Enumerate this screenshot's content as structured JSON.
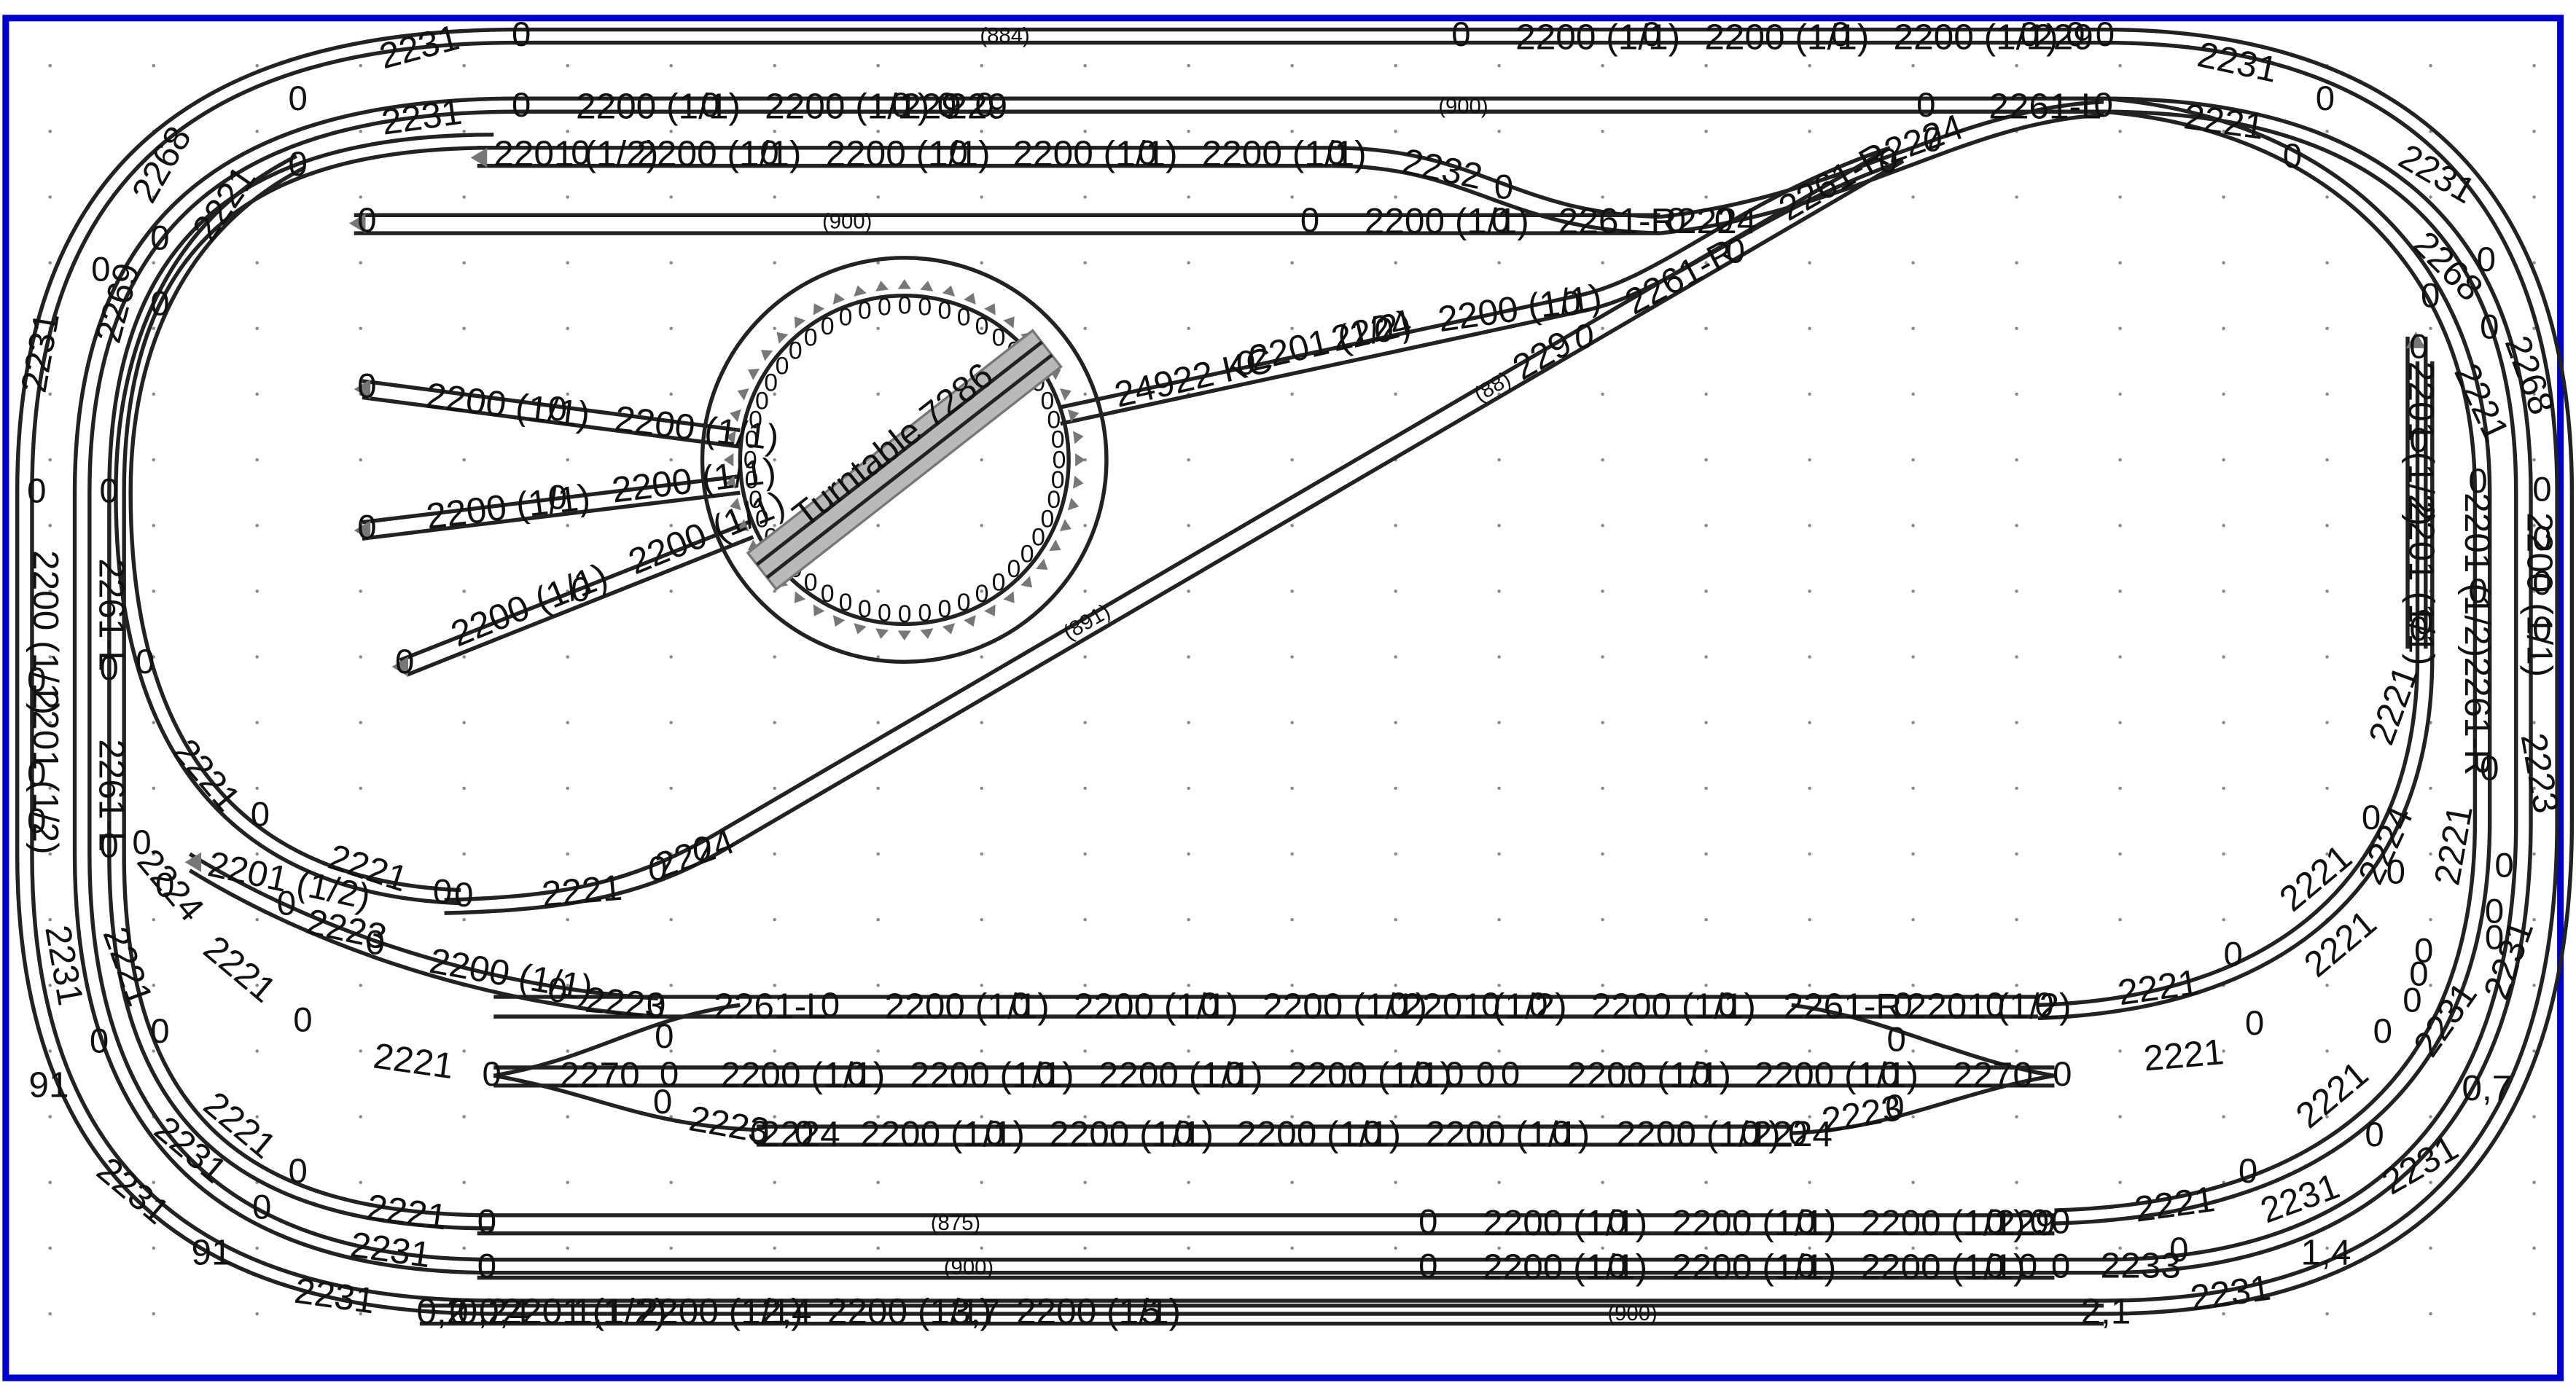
{
  "diagram": {
    "type": "model railway track plan",
    "colors": {
      "frame": "#0000cc",
      "track": "#222222",
      "turntable_bridge": "#b9b9b9",
      "grid_dots": "#8a8a8a"
    },
    "turntable": {
      "label": "Turntable 7286",
      "stall_marker": "0"
    },
    "labels": {
      "t884": "(884)",
      "t900": "(900)",
      "t875": "(875)",
      "t891": "(891)",
      "t88": "(88)",
      "p2200": "2200 (1/1)",
      "p2201h": "2201 (1/2)",
      "p2201f": "2201 (1/1)",
      "p2221": "2221",
      "p2231": "2231",
      "p2268": "2268",
      "p2269": "2269",
      "p2261L": "2261-L",
      "p2261R": "2261-R",
      "p2223": "2223",
      "p2224": "2224",
      "p2232": "2232",
      "p2233": "2233",
      "p2270": "2270",
      "p2229": "229",
      "p24922": "24922 KC",
      "zero": "0",
      "n02": "0,2",
      "n04": "0,4",
      "n11": "1,1",
      "n24": "2,4",
      "n37": "3,7",
      "n5": "5",
      "n21": "2,1",
      "n14": "1,4",
      "n91": "91",
      "n07": "0,7"
    }
  }
}
